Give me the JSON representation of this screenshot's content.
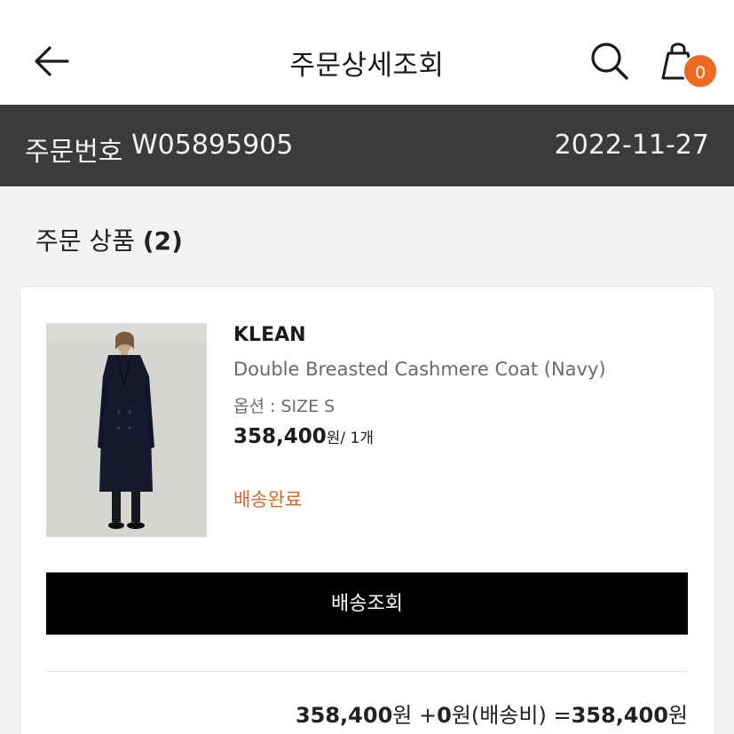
{
  "header": {
    "title": "주문상세조회",
    "cart_count": "0",
    "icons": [
      "back-arrow-icon",
      "search-icon",
      "shopping-bag-icon"
    ]
  },
  "order": {
    "label": "주문번호",
    "number": "W05895905",
    "date": "2022-11-27"
  },
  "section": {
    "title": "주문 상품 ",
    "count": "(2)"
  },
  "product": {
    "brand": "KLEAN",
    "name": "Double Breasted Cashmere Coat (Navy)",
    "option": "옵션 : SIZE S",
    "price": "358,400",
    "price_unit": "원/ 1개",
    "status": "배송완료",
    "status_color": "#d06a2a",
    "image_alt": "model wearing navy coat"
  },
  "actions": {
    "track_label": "배송조회"
  },
  "totals": {
    "product_amount": "358,400",
    "won1": "원 +",
    "shipping_amount": "0",
    "shipping_label": "원(배송비) =",
    "total_amount": "358,400",
    "won2": "원"
  },
  "colors": {
    "accent_orange": "#ee6a22",
    "order_bar": "#3b3b3b",
    "button": "#000000"
  }
}
